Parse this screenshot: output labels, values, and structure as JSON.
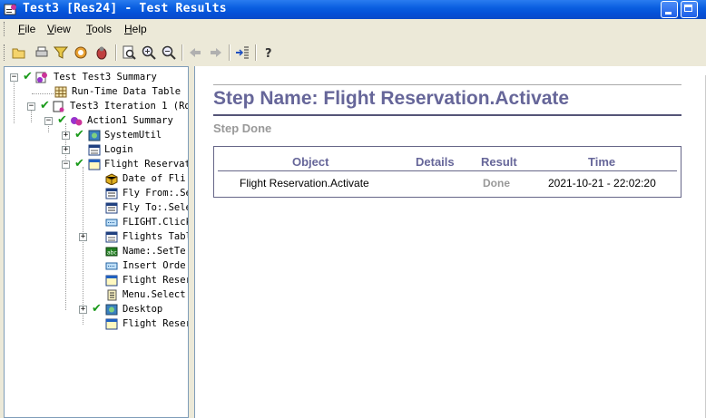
{
  "window": {
    "title": "Test3 [Res24] - Test Results"
  },
  "menu": {
    "items": [
      {
        "label": "File",
        "accel": "F"
      },
      {
        "label": "View",
        "accel": "V"
      },
      {
        "label": "Tools",
        "accel": "T"
      },
      {
        "label": "Help",
        "accel": "H"
      }
    ]
  },
  "toolbar": {
    "buttons": [
      "open-icon",
      "print-icon",
      "filter-icon",
      "find-icon",
      "bug-icon",
      "preview-icon",
      "zoom-in-icon",
      "zoom-out-icon",
      "back-arrow-icon",
      "forward-arrow-icon",
      "jump-to-step-icon",
      "help-icon"
    ]
  },
  "tree": {
    "nodes": [
      {
        "label": "Test Test3 Summary",
        "icon": "test-summary-icon"
      },
      {
        "label": "Run-Time Data Table",
        "icon": "data-table-icon"
      },
      {
        "label": "Test3 Iteration 1 (Ro",
        "icon": "iteration-icon"
      },
      {
        "label": "Action1 Summary",
        "icon": "action-icon"
      },
      {
        "label": "SystemUtil",
        "icon": "systemutil-icon"
      },
      {
        "label": "Login",
        "icon": "dialog-icon"
      },
      {
        "label": "Flight Reservati",
        "icon": "window-icon"
      },
      {
        "label": "Date of Fli",
        "icon": "object-icon"
      },
      {
        "label": "Fly From:.Se",
        "icon": "combobox-icon"
      },
      {
        "label": "Fly To:.Sele",
        "icon": "combobox-icon"
      },
      {
        "label": "FLIGHT.Click",
        "icon": "button-icon"
      },
      {
        "label": "Flights Tabl",
        "icon": "dialog-icon"
      },
      {
        "label": "Name:.SetTe",
        "icon": "edit-icon"
      },
      {
        "label": "Insert Orde",
        "icon": "button-icon"
      },
      {
        "label": "Flight Reser",
        "icon": "window-icon"
      },
      {
        "label": "Menu.Select",
        "icon": "menu-icon"
      },
      {
        "label": "Desktop",
        "icon": "desktop-icon"
      },
      {
        "label": "Flight Reser",
        "icon": "window-icon"
      }
    ]
  },
  "step": {
    "title": "Step Name: Flight Reservation.Activate",
    "status_heading": "Step Done",
    "table": {
      "headers": [
        "Object",
        "Details",
        "Result",
        "Time"
      ],
      "rows": [
        [
          "Flight Reservation.Activate",
          "",
          "Done",
          "2021-10-21 - 22:02:20"
        ]
      ]
    }
  },
  "colors": {
    "title_bar": "#0a5fe0",
    "heading": "#666699",
    "done": "#999999",
    "check": "#1a9a1a"
  }
}
